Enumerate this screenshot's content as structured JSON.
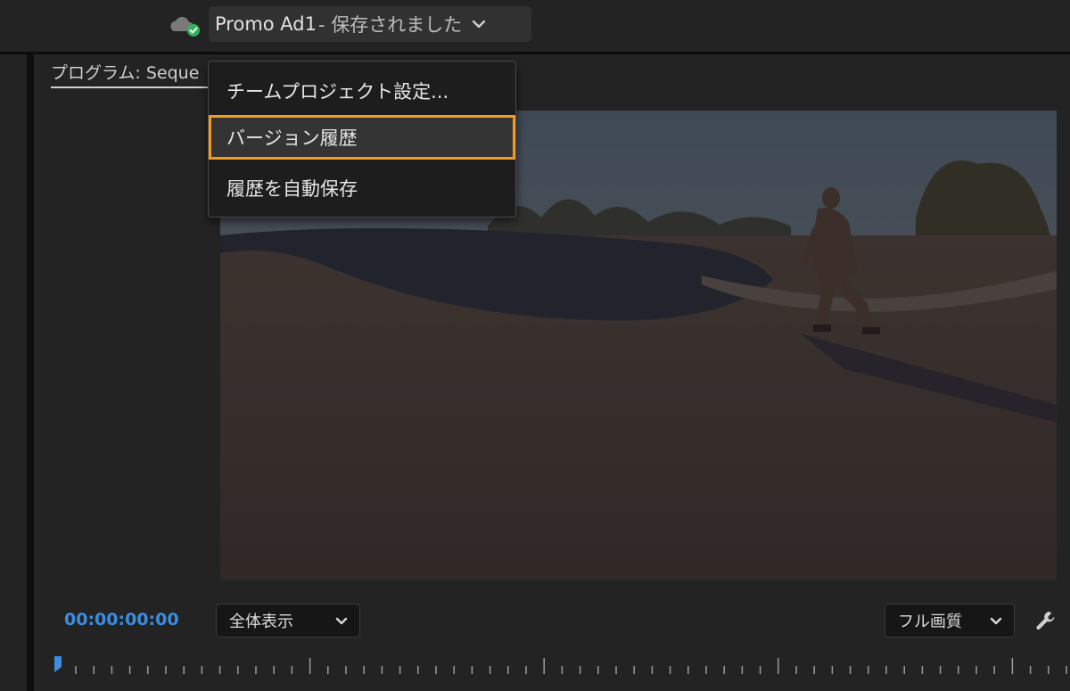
{
  "header": {
    "project_name": "Promo Ad1",
    "save_status": "- 保存されました",
    "cloud_status_icon": "cloud-synced-icon",
    "status_color": "#2fb35a"
  },
  "panel": {
    "tab_label": "プログラム: Seque"
  },
  "menu": {
    "items": [
      {
        "label": "チームプロジェクト設定..."
      },
      {
        "label": "バージョン履歴",
        "highlighted": true
      },
      {
        "label": "履歴を自動保存"
      }
    ],
    "highlight_color": "#f29a24"
  },
  "controls": {
    "timecode": "00:00:00:00",
    "timecode_color": "#3c8dde",
    "fit_select": {
      "value": "全体表示"
    },
    "quality_select": {
      "value": "フル画質"
    },
    "settings_icon": "wrench-icon"
  }
}
